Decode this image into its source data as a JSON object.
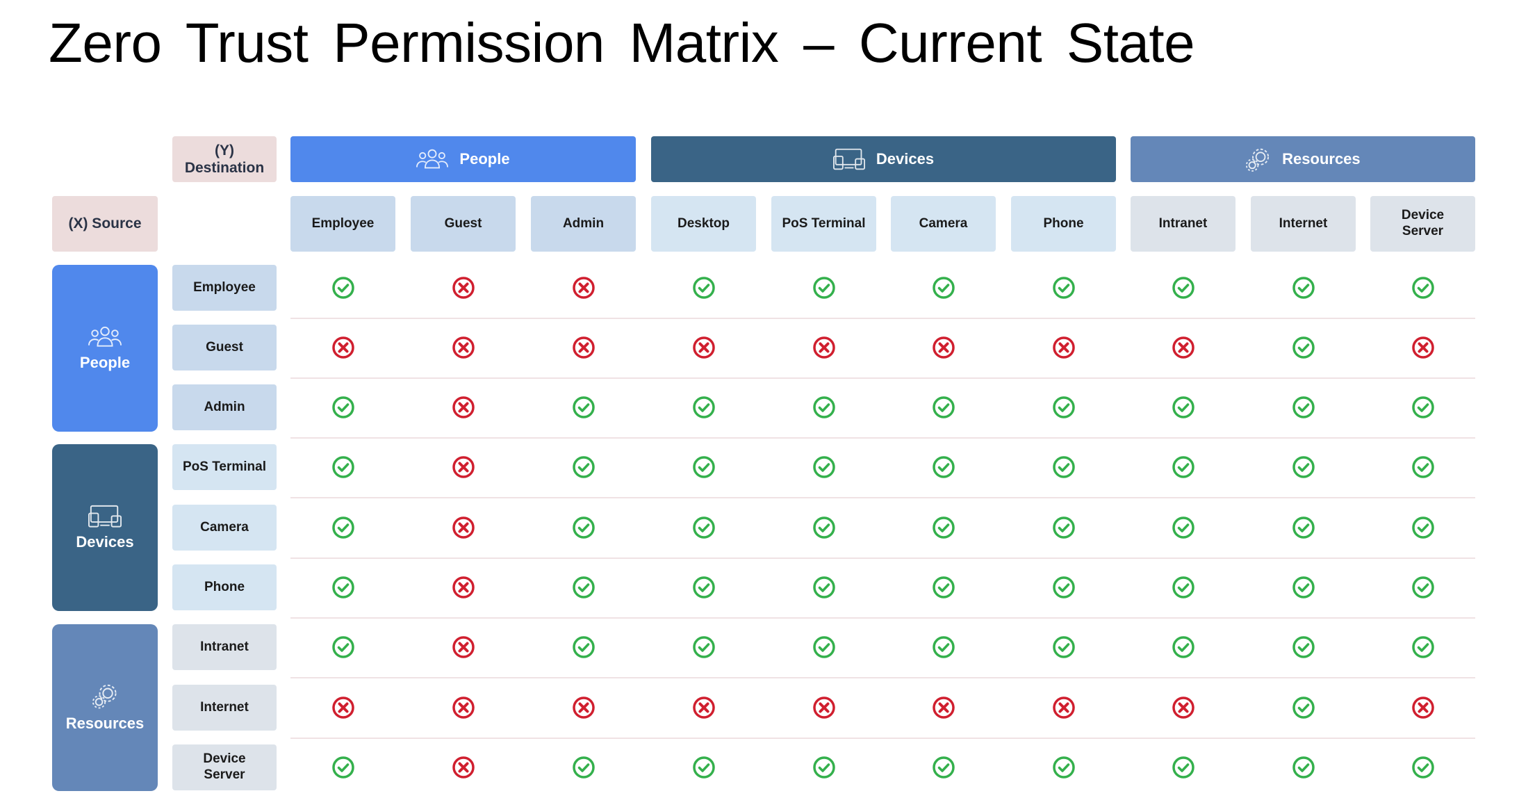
{
  "title": "Zero Trust Permission Matrix – Current State",
  "corner": {
    "destination": "(Y)\nDestination",
    "source": "(X) Source"
  },
  "colors": {
    "people": "#5088ec",
    "devices": "#3a6486",
    "resources": "#6487b8",
    "allow": "#34b04c",
    "deny": "#d01f2f"
  },
  "column_groups": [
    {
      "label": "People",
      "icon": "people-group-icon"
    },
    {
      "label": "Devices",
      "icon": "devices-icon"
    },
    {
      "label": "Resources",
      "icon": "resources-gear-icon"
    }
  ],
  "columns": [
    "Employee",
    "Guest",
    "Admin",
    "Desktop",
    "PoS Terminal",
    "Camera",
    "Phone",
    "Intranet",
    "Internet",
    "Device\nServer"
  ],
  "row_groups": [
    {
      "label": "People",
      "icon": "people-group-icon"
    },
    {
      "label": "Devices",
      "icon": "devices-icon"
    },
    {
      "label": "Resources",
      "icon": "resources-gear-icon"
    }
  ],
  "rows": [
    "Employee",
    "Guest",
    "Admin",
    "PoS Terminal",
    "Camera",
    "Phone",
    "Intranet",
    "Internet",
    "Device\nServer"
  ],
  "matrix": [
    [
      "allow",
      "deny",
      "deny",
      "allow",
      "allow",
      "allow",
      "allow",
      "allow",
      "allow",
      "allow"
    ],
    [
      "deny",
      "deny",
      "deny",
      "deny",
      "deny",
      "deny",
      "deny",
      "deny",
      "allow",
      "deny"
    ],
    [
      "allow",
      "deny",
      "allow",
      "allow",
      "allow",
      "allow",
      "allow",
      "allow",
      "allow",
      "allow"
    ],
    [
      "allow",
      "deny",
      "allow",
      "allow",
      "allow",
      "allow",
      "allow",
      "allow",
      "allow",
      "allow"
    ],
    [
      "allow",
      "deny",
      "allow",
      "allow",
      "allow",
      "allow",
      "allow",
      "allow",
      "allow",
      "allow"
    ],
    [
      "allow",
      "deny",
      "allow",
      "allow",
      "allow",
      "allow",
      "allow",
      "allow",
      "allow",
      "allow"
    ],
    [
      "allow",
      "deny",
      "allow",
      "allow",
      "allow",
      "allow",
      "allow",
      "allow",
      "allow",
      "allow"
    ],
    [
      "deny",
      "deny",
      "deny",
      "deny",
      "deny",
      "deny",
      "deny",
      "deny",
      "allow",
      "deny"
    ],
    [
      "allow",
      "deny",
      "allow",
      "allow",
      "allow",
      "allow",
      "allow",
      "allow",
      "allow",
      "allow"
    ]
  ]
}
